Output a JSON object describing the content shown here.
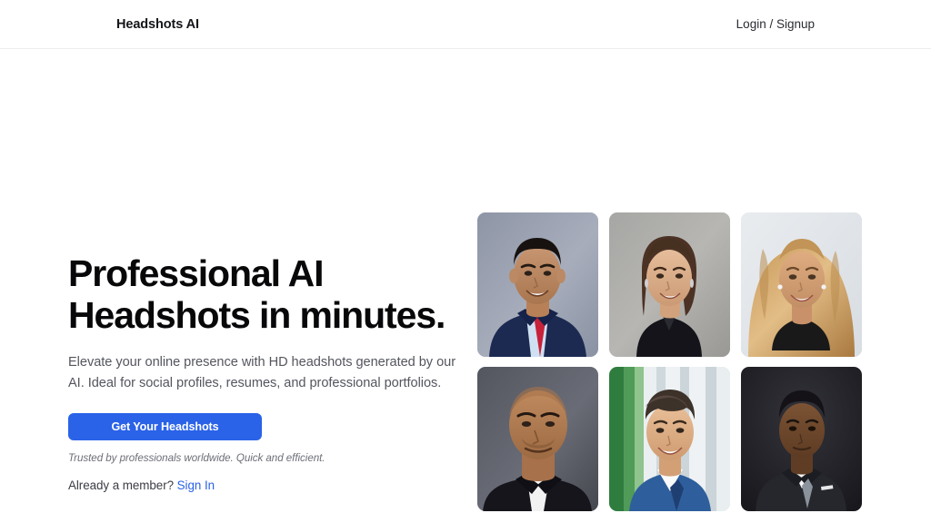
{
  "header": {
    "brand": "Headshots AI",
    "login_link": "Login / Signup"
  },
  "hero": {
    "title_line1": "Professional AI",
    "title_line2": "Headshots in minutes.",
    "subtitle": "Elevate your online presence with HD headshots generated by our AI. Ideal for social profiles, resumes, and professional portfolios.",
    "cta_label": "Get Your Headshots",
    "trust_note": "Trusted by professionals worldwide. Quick and efficient.",
    "member_prompt": "Already a member?",
    "signin_label": "Sign In"
  },
  "gallery": {
    "items": [
      {
        "name": "headshot-man-navy-suit-red-tie",
        "alt": "Smiling man in navy suit with red tie on gray background"
      },
      {
        "name": "headshot-woman-black-blazer",
        "alt": "Smiling woman with long brown hair in black blazer on gray background"
      },
      {
        "name": "headshot-woman-blonde-wavy-hair",
        "alt": "Smiling woman with blonde wavy hair on light background"
      },
      {
        "name": "headshot-bald-man-dark-suit",
        "alt": "Bald man in dark suit on gray background"
      },
      {
        "name": "headshot-young-man-blue-suit",
        "alt": "Smiling young man in blue suit with green blurred background"
      },
      {
        "name": "headshot-man-charcoal-suit",
        "alt": "Man in charcoal suit with tie on dark background"
      }
    ]
  },
  "colors": {
    "accent_blue": "#2a62e8",
    "text_primary": "#08080a",
    "text_muted": "#54565e",
    "border": "#ededf0",
    "background": "#ffffff"
  }
}
